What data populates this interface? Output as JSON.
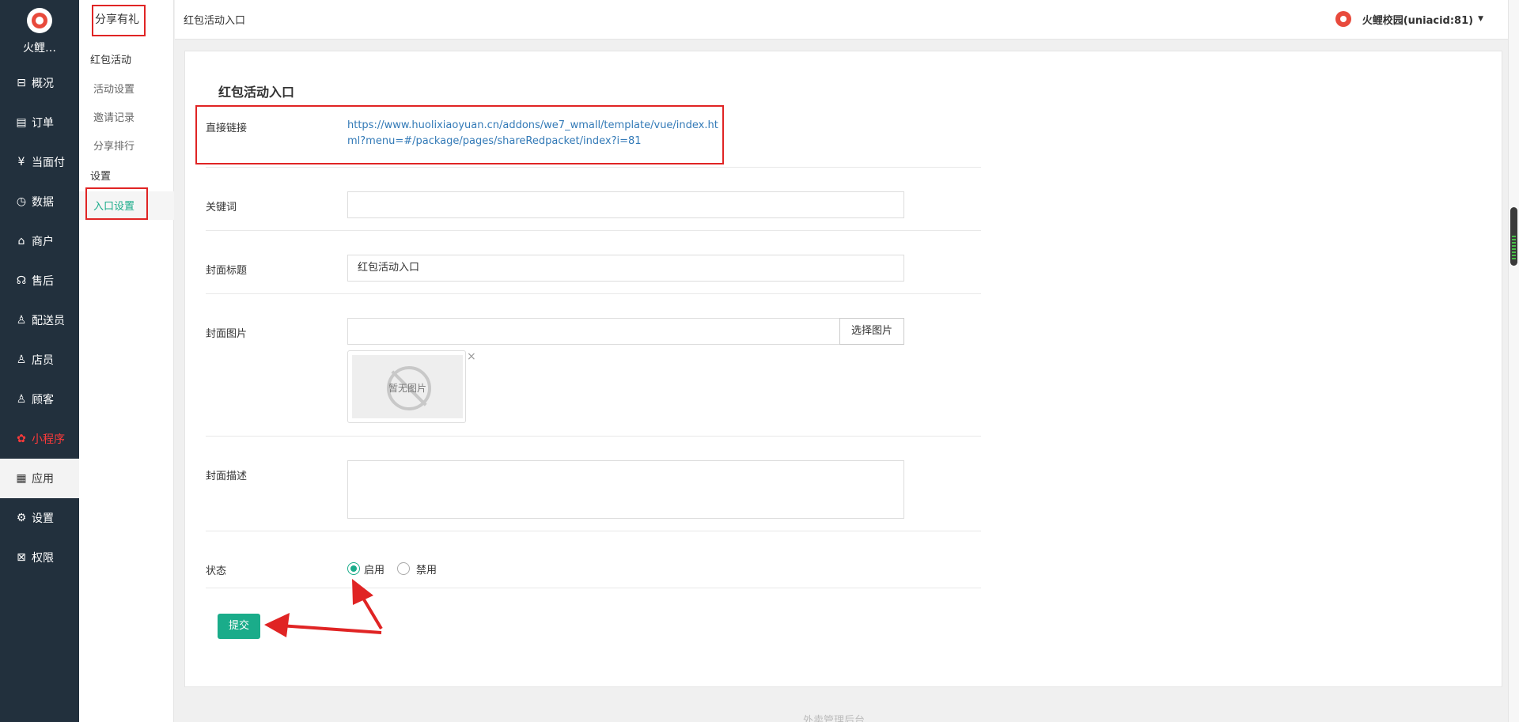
{
  "app": {
    "brand": "火鲤…"
  },
  "nav": {
    "items": [
      {
        "icon": "overview-icon",
        "glyph": "⊟",
        "label": "概况"
      },
      {
        "icon": "order-icon",
        "glyph": "▤",
        "label": "订单"
      },
      {
        "icon": "pay-icon",
        "glyph": "¥",
        "label": "当面付"
      },
      {
        "icon": "data-icon",
        "glyph": "◷",
        "label": "数据"
      },
      {
        "icon": "store-icon",
        "glyph": "⌂",
        "label": "商户"
      },
      {
        "icon": "after-sale-icon",
        "glyph": "☊",
        "label": "售后"
      },
      {
        "icon": "courier-icon",
        "glyph": "♙",
        "label": "配送员"
      },
      {
        "icon": "clerk-icon",
        "glyph": "♙",
        "label": "店员"
      },
      {
        "icon": "customer-icon",
        "glyph": "♙",
        "label": "顾客"
      },
      {
        "icon": "miniprogram-icon",
        "glyph": "✿",
        "label": "小程序"
      },
      {
        "icon": "apps-icon",
        "glyph": "▦",
        "label": "应用"
      },
      {
        "icon": "settings-icon",
        "glyph": "⚙",
        "label": "设置"
      },
      {
        "icon": "permission-icon",
        "glyph": "⊠",
        "label": "权限"
      }
    ]
  },
  "subnav": {
    "title": "分享有礼",
    "group1": "红包活动",
    "links": [
      "活动设置",
      "邀请记录",
      "分享排行"
    ],
    "group2": "设置",
    "active": "入口设置"
  },
  "header": {
    "breadcrumb": "红包活动入口",
    "account": "火鲤校园(uniacid:81)"
  },
  "form": {
    "heading": "红包活动入口",
    "direct_link_label": "直接链接",
    "direct_link": "https://www.huolixiaoyuan.cn/addons/we7_wmall/template/vue/index.html?menu=#/package/pages/shareRedpacket/index?i=81",
    "keyword_label": "关键词",
    "keyword_value": "",
    "cover_title_label": "封面标题",
    "cover_title_value": "红包活动入口",
    "cover_image_label": "封面图片",
    "cover_image_value": "",
    "select_image": "选择图片",
    "no_image": "暂无图片",
    "remove": "×",
    "cover_desc_label": "封面描述",
    "status_label": "状态",
    "status_enabled": "启用",
    "status_disabled": "禁用",
    "status_selected": "启用",
    "submit": "提交"
  },
  "footer": {
    "text": "外卖管理后台"
  },
  "colors": {
    "sidebar": "#22303d",
    "accent": "#1aac8a",
    "annotation": "#e02424",
    "link": "#337ab7"
  }
}
